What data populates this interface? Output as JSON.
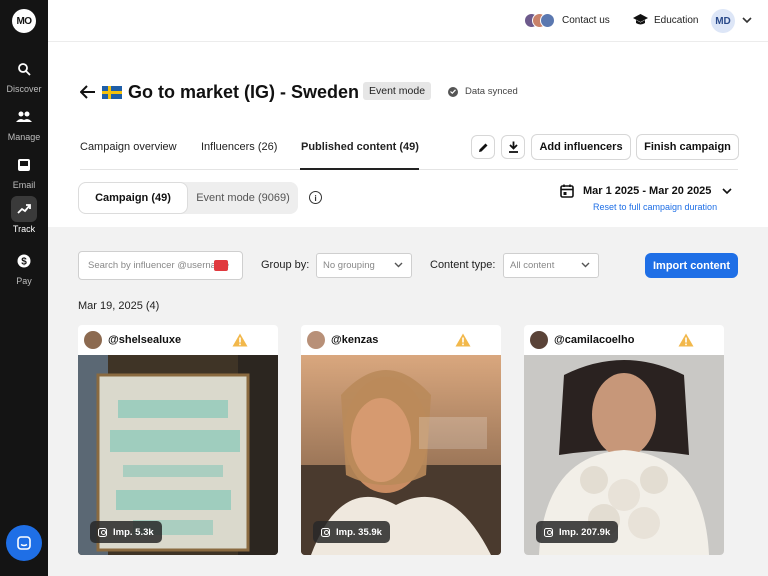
{
  "sidebar": {
    "logo": "MO",
    "items": [
      {
        "label": "Discover",
        "icon": "search-icon"
      },
      {
        "label": "Manage",
        "icon": "people-icon"
      },
      {
        "label": "Email",
        "icon": "inbox-icon"
      },
      {
        "label": "Track",
        "icon": "trending-icon",
        "active": true
      },
      {
        "label": "Pay",
        "icon": "dollar-icon"
      }
    ]
  },
  "topbar": {
    "contact_label": "Contact us",
    "education_label": "Education",
    "user_initials": "MD"
  },
  "header": {
    "title": "Go to market (IG) - Sweden",
    "mode_badge": "Event mode",
    "sync_status": "Data synced"
  },
  "tabs": [
    {
      "label": "Campaign overview"
    },
    {
      "label": "Influencers (26)"
    },
    {
      "label": "Published content (49)",
      "active": true
    }
  ],
  "actions": {
    "add_influencers": "Add influencers",
    "finish_campaign": "Finish campaign"
  },
  "segmented": {
    "campaign": "Campaign (49)",
    "event_mode": "Event mode (9069)"
  },
  "date_range": {
    "label": "Mar 1 2025 - Mar 20 2025",
    "reset": "Reset to full campaign duration"
  },
  "filters": {
    "search_placeholder": "Search by influencer @username",
    "group_by_label": "Group by:",
    "group_by_value": "No grouping",
    "content_type_label": "Content type:",
    "content_type_value": "All content",
    "import_button": "Import content"
  },
  "group": {
    "date_label": "Mar 19, 2025 (4)"
  },
  "cards": [
    {
      "handle": "@shelsealuxe",
      "impressions": "Imp. 5.3k"
    },
    {
      "handle": "@kenzas",
      "impressions": "Imp. 35.9k"
    },
    {
      "handle": "@camilacoelho",
      "impressions": "Imp. 207.9k"
    }
  ],
  "colors": {
    "accent": "#1f6fe6",
    "sidebar_bg": "#141414",
    "warning": "#f2b84b"
  }
}
